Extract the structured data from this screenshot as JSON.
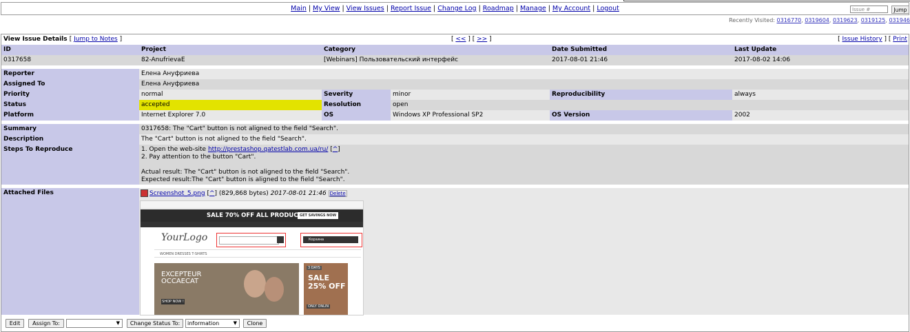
{
  "nav": {
    "links": [
      "Main",
      "My View",
      "View Issues",
      "Report Issue",
      "Change Log",
      "Roadmap",
      "Manage",
      "My Account",
      "Logout"
    ],
    "jump_placeholder": "Issue #",
    "jump_label": "Jump"
  },
  "recent": {
    "label": "Recently Visited:",
    "items": [
      "0316770",
      "0319604",
      "0319623",
      "0319125",
      "031946"
    ]
  },
  "title": {
    "heading": "View Issue Details",
    "jump_notes": "Jump to Notes",
    "prev": "<<",
    "next": ">>",
    "history": "Issue History",
    "print": "Print"
  },
  "header": {
    "id": "ID",
    "project": "Project",
    "category": "Category",
    "date_submitted": "Date Submitted",
    "last_update": "Last Update"
  },
  "issue": {
    "id": "0317658",
    "project": "82-AnufrievaE",
    "category": "[Webinars] Пользовательский интерфейс",
    "date_submitted": "2017-08-01 21:46",
    "last_update": "2017-08-02 14:06"
  },
  "labels": {
    "reporter": "Reporter",
    "assigned_to": "Assigned To",
    "priority": "Priority",
    "severity": "Severity",
    "reproducibility": "Reproducibility",
    "status": "Status",
    "resolution": "Resolution",
    "platform": "Platform",
    "os": "OS",
    "os_version": "OS Version",
    "summary": "Summary",
    "description": "Description",
    "steps": "Steps To Reproduce",
    "attached": "Attached Files"
  },
  "values": {
    "reporter": "Елена Ануфриева",
    "assigned_to": "Елена Ануфриева",
    "priority": "normal",
    "severity": "minor",
    "reproducibility": "always",
    "status": "accepted",
    "resolution": "open",
    "platform": "Internet Explorer 7.0",
    "os": "Windows XP Professional SP2",
    "os_version": "2002",
    "summary": "0317658: The \"Cart\" button is not aligned to the field \"Search\".",
    "description": "The \"Cart\" button is not aligned to the field \"Search\".",
    "steps_1_pre": "1. Open the web-site ",
    "steps_link": "http://prestashop.qatestlab.com.ua/ru/",
    "steps_caret": "^",
    "steps_rest": "2. Pay attention to the button \"Cart\".\n\nActual result: The \"Cart\" button is not aligned to the field \"Search\".\nExpected result:The \"Cart\" button is aligned to the field \"Search\"."
  },
  "attachment": {
    "filename": "Screenshot_5.png",
    "caret": "^",
    "size": "(829,868 bytes)",
    "date": "2017-08-01 21:46",
    "delete": "Delete",
    "thumb": {
      "promo": "SALE 70% OFF ALL PRODUCTS",
      "promo_btn": "GET SAVINGS NOW",
      "logo": "YourLogo",
      "cart": "Корзина",
      "menu": "WOMEN    DRESSES    T-SHIRTS",
      "hero": "EXCEPTEUR\nOCCAECAT",
      "hero_btn": "SHOP NOW !",
      "side_tag": "3 DAYS",
      "side": "SALE\n25% OFF",
      "side_bottom": "ONLY ONLIN"
    }
  },
  "actions": {
    "edit": "Edit",
    "assign": "Assign To:",
    "assign_value": "",
    "change_status": "Change Status To:",
    "status_value": "information",
    "clone": "Clone"
  }
}
